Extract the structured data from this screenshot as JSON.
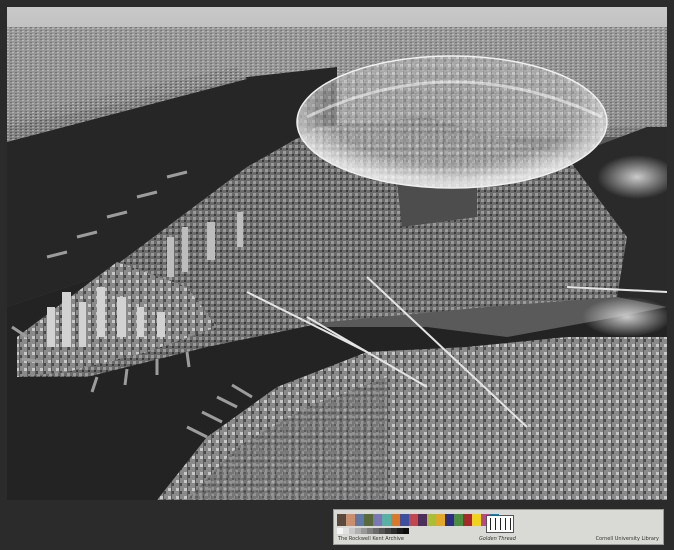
{
  "photo": {
    "subject": "aerial-photograph-manhattan-dome"
  },
  "color_target": {
    "swatch_colors": [
      "#5b4a3c",
      "#c98f6f",
      "#5f77a3",
      "#58693c",
      "#7a78b4",
      "#5bb0a4",
      "#d9782a",
      "#3f4f9f",
      "#c2474f",
      "#4d2f5c",
      "#a8bf36",
      "#e3a72a",
      "#2b2f7d",
      "#4d8d3f",
      "#a62a2a",
      "#f0d21f",
      "#b44a8b",
      "#1b7fa6"
    ],
    "gray_steps": [
      "#f5f5f5",
      "#e0e0e0",
      "#c8c8c8",
      "#b0b0b0",
      "#989898",
      "#808080",
      "#6a6a6a",
      "#545454",
      "#404040",
      "#2c2c2c",
      "#1a1a1a",
      "#0d0d0d"
    ],
    "label_left": "The Rockwell Kent Archive",
    "label_center": "Golden Thread",
    "label_right": "Cornell University Library"
  }
}
